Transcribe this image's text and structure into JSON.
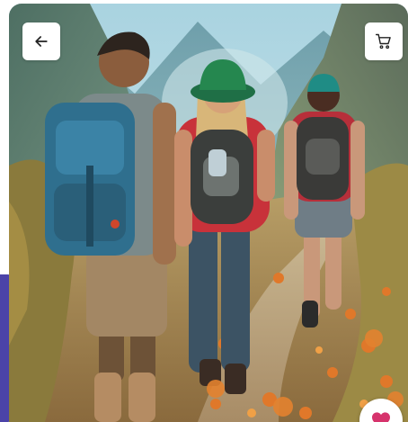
{
  "screen": {
    "photo": {
      "alt_subject": "hikers-on-trail-photo"
    },
    "back_button": {
      "icon": "arrow-left-icon"
    },
    "cart_button": {
      "icon": "shopping-cart-icon"
    },
    "favorite_button": {
      "icon": "heart-icon",
      "color": "#d6336c"
    },
    "accent_color": "#4b43a8"
  }
}
